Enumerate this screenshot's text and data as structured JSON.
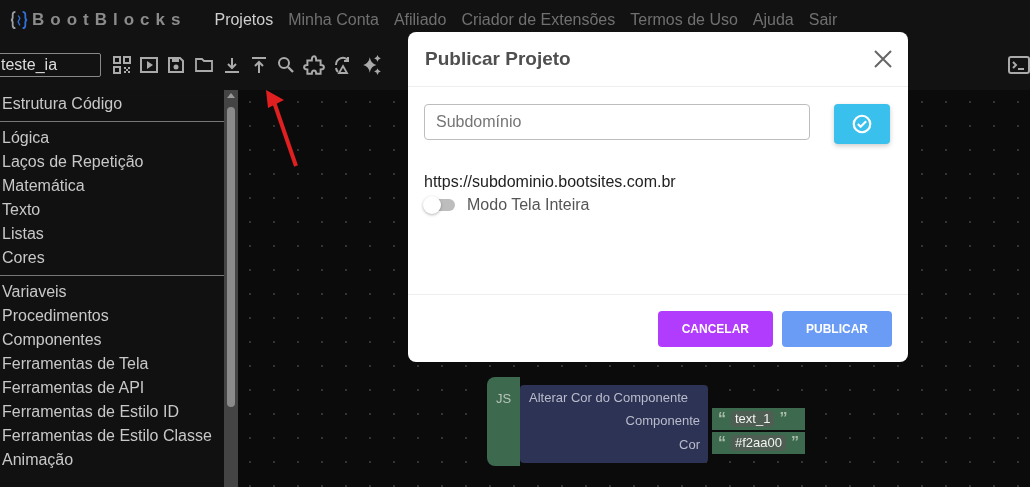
{
  "logo": {
    "text": "BootBlocks"
  },
  "nav": [
    {
      "label": "Projetos",
      "selected": true
    },
    {
      "label": "Minha Conta",
      "selected": false
    },
    {
      "label": "Afiliado",
      "selected": false
    },
    {
      "label": "Criador de Extensões",
      "selected": false
    },
    {
      "label": "Termos de Uso",
      "selected": false
    },
    {
      "label": "Ajuda",
      "selected": false
    },
    {
      "label": "Sair",
      "selected": false
    }
  ],
  "project_field": {
    "value": "teste_ia"
  },
  "sidebar": {
    "sections": [
      {
        "items": [
          "Estrutura Código"
        ]
      },
      {
        "items": [
          "Lógica",
          "Laços de Repetição",
          "Matemática",
          "Texto",
          "Listas",
          "Cores"
        ]
      },
      {
        "items": [
          "Variaveis",
          "Procedimentos",
          "Componentes",
          "Ferramentas de Tela",
          "Ferramentas de API",
          "Ferramentas de Estilo ID",
          "Ferramentas de Estilo Classe",
          "Animação"
        ]
      }
    ]
  },
  "canvas": {
    "block": {
      "hat": "JS",
      "title": "Alterar Cor do Componente",
      "inputs": [
        {
          "label": "Componente",
          "quote_open": "“",
          "value": "text_1",
          "quote_close": "”"
        },
        {
          "label": "Cor",
          "quote_open": "“",
          "value": "#f2aa00",
          "quote_close": "”"
        }
      ]
    }
  },
  "modal": {
    "title": "Publicar Projeto",
    "subdomain": {
      "placeholder": "Subdomínio"
    },
    "url": "https://subdominio.bootsites.com.br",
    "fullscreen_toggle": {
      "label": "Modo Tela Inteira",
      "on": false
    },
    "buttons": [
      {
        "label": "CANCELAR",
        "kind": "cancel"
      },
      {
        "label": "PUBLICAR",
        "kind": "publish"
      }
    ]
  }
}
